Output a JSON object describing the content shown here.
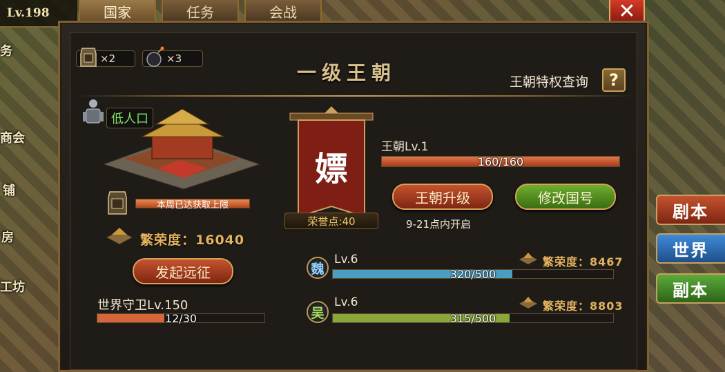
{
  "top": {
    "level": "Lv.198",
    "tabs": [
      "国家",
      "任务",
      "会战"
    ],
    "active_tab": 0
  },
  "left_edge": {
    "labels": [
      "务",
      "商会",
      "铺",
      "房",
      "工坊"
    ]
  },
  "right_side": {
    "buttons": [
      {
        "label": "剧本",
        "color": "#a5391f"
      },
      {
        "label": "世界",
        "color": "#2d6fb8"
      },
      {
        "label": "副本",
        "color": "#3f8a2a"
      }
    ]
  },
  "panel": {
    "title": "一级王朝",
    "privilege_label": "王朝特权查询",
    "help_label": "?",
    "item_counts": [
      {
        "icon": "expedition-token-icon",
        "value": "×2"
      },
      {
        "icon": "bomb-icon",
        "value": "×3"
      }
    ],
    "population_badge": "低人口",
    "weekly_limit_text": "本周已达获取上限",
    "prosperity": "繁荣度：16040",
    "expedition_button": "发起远征",
    "world_guard": {
      "label": "世界守卫Lv.150",
      "progress_text": "12/30",
      "progress": 0.4
    },
    "banner": {
      "character": "嫖",
      "honor_points": "荣誉点:40"
    },
    "dynasty": {
      "level_label": "王朝Lv.1",
      "progress_text": "160/160",
      "progress": 1.0,
      "upgrade_button": "王朝升级",
      "rename_button": "修改国号",
      "open_time": "9-21点内开启"
    },
    "kingdoms": [
      {
        "badge": "魏",
        "badge_color": "#8fd0ff",
        "level": "Lv.6",
        "prosperity": "繁荣度：8467",
        "progress_text": "320/500",
        "progress": 0.64,
        "bar_color": "#4a9ec0"
      },
      {
        "badge": "吴",
        "badge_color": "#a6e05a",
        "level": "Lv.6",
        "prosperity": "繁荣度：8803",
        "progress_text": "315/500",
        "progress": 0.63,
        "bar_color": "#8aa83a"
      }
    ]
  },
  "colors": {
    "accent_gold": "#c9a060",
    "prosperity_gold": "#e4b35e",
    "bar_red": "#d4663a"
  }
}
